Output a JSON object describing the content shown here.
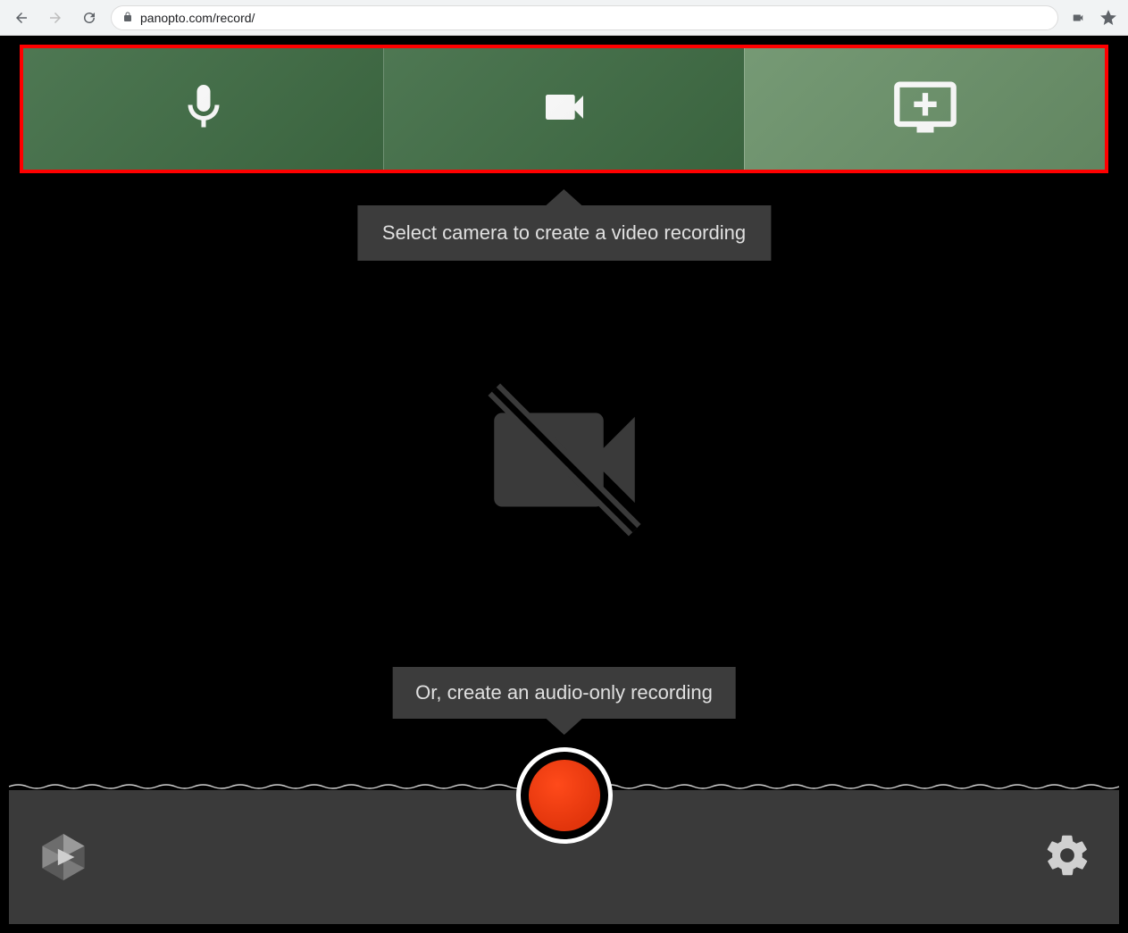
{
  "browser": {
    "url": "panopto.com/record/"
  },
  "source_tabs": {
    "audio_label": "Audio",
    "video_label": "Video",
    "screen_label": "Screens and Apps"
  },
  "tooltips": {
    "select_camera": "Select camera to create a video recording",
    "audio_only": "Or, create an audio-only recording"
  },
  "colors": {
    "tab_green": "#3f6c44",
    "tab_green_light": "#6a9169",
    "highlight_red": "#ff0000",
    "record_red": "#e2350c",
    "tooltip_bg": "#3c3c3c",
    "bottom_bar": "#3a3a3a"
  }
}
